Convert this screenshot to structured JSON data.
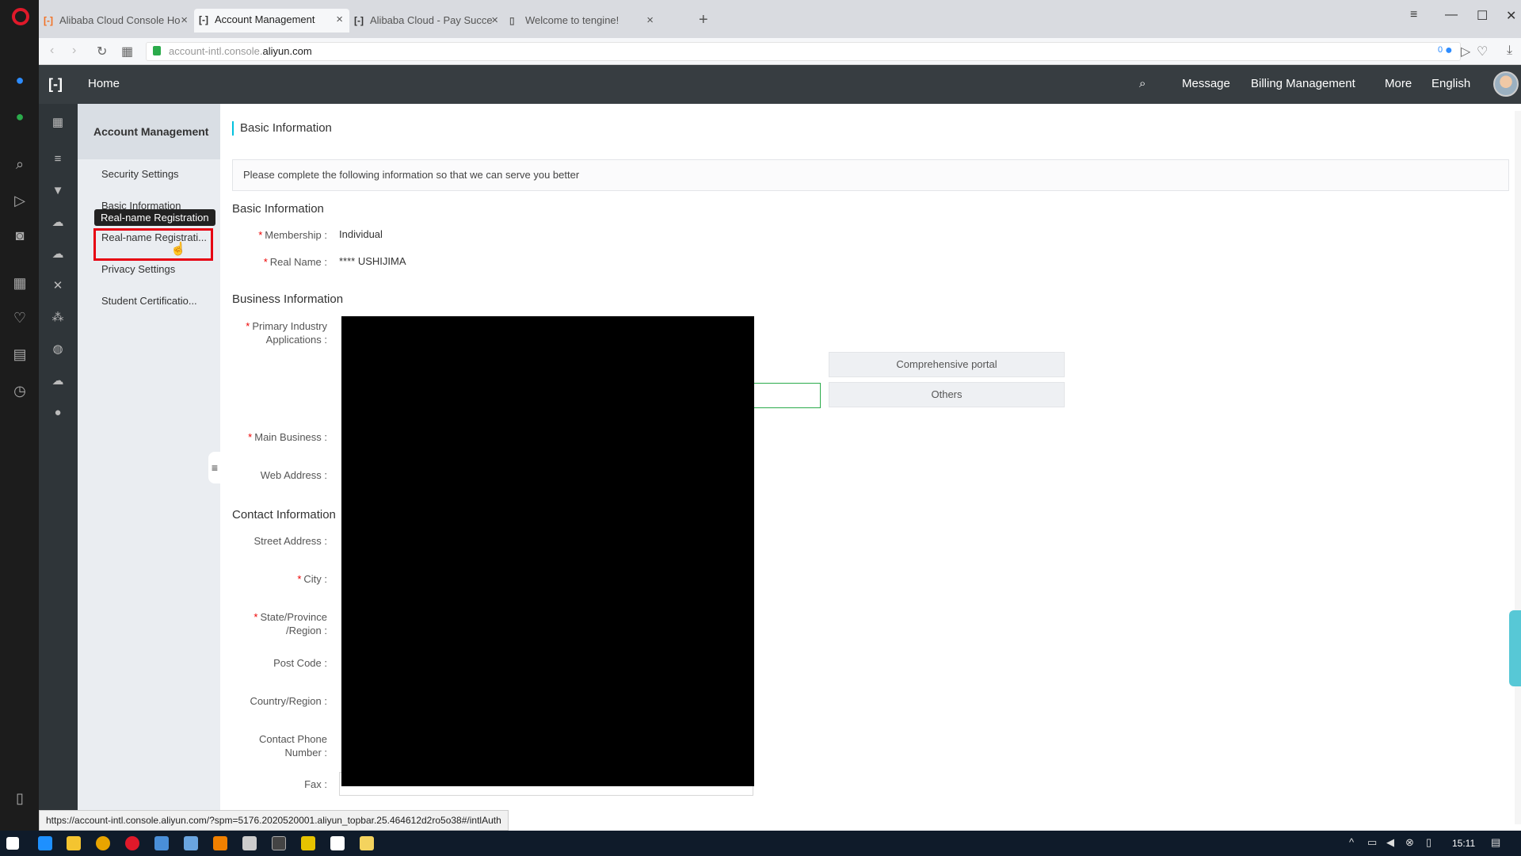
{
  "browser": {
    "tabs": [
      {
        "label": "Alibaba Cloud Console Ho",
        "active": false
      },
      {
        "label": "Account Management",
        "active": true
      },
      {
        "label": "Alibaba Cloud - Pay Succe",
        "active": false
      },
      {
        "label": "Welcome to tengine!",
        "active": false
      }
    ],
    "url_prefix": "account-intl.console.",
    "url_domain": "aliyun.com",
    "status_url": "https://account-intl.console.aliyun.com/?spm=5176.2020520001.aliyun_topbar.25.464612d2ro5o38#/intlAuth",
    "adblock_count": "0"
  },
  "header": {
    "home": "Home",
    "message": "Message",
    "billing": "Billing Management",
    "more": "More",
    "language": "English"
  },
  "subnav": {
    "title": "Account Management",
    "items": [
      "Security Settings",
      "Basic Information",
      "Real-name Registrati...",
      "Privacy Settings",
      "Student Certificatio..."
    ],
    "tooltip": "Real-name Registration"
  },
  "main": {
    "page_title": "Basic Information",
    "notice": "Please complete the following information so that we can serve you better",
    "basic": {
      "heading": "Basic Information",
      "membership_label": "Membership :",
      "membership_value": "Individual",
      "realname_label": "Real Name :",
      "realname_value": "**** USHIJIMA"
    },
    "business": {
      "heading": "Business Information",
      "industry_label_1": "Primary Industry",
      "industry_label_2": "Applications :",
      "industry_options": [
        "Comprehensive portal",
        "Others"
      ],
      "main_business_label": "Main Business :",
      "web_address_label": "Web Address :"
    },
    "contact": {
      "heading": "Contact Information",
      "street_label": "Street Address :",
      "city_label": "City :",
      "state_label_1": "State/Province",
      "state_label_2": "/Region :",
      "post_label": "Post Code :",
      "country_label": "Country/Region :",
      "phone_label_1": "Contact Phone",
      "phone_label_2": "Number :",
      "fax_label": "Fax :"
    }
  },
  "taskbar": {
    "clock": "15:11"
  }
}
